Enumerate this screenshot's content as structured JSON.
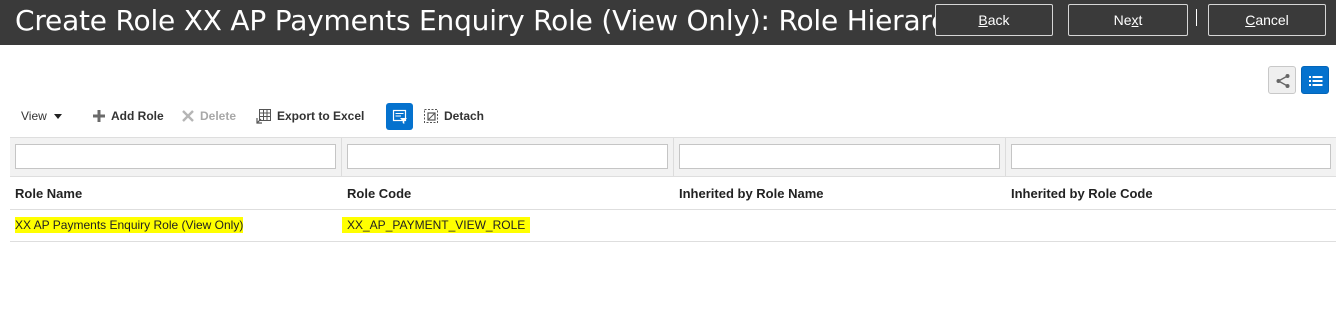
{
  "header": {
    "title": "Create Role XX AP Payments Enquiry Role (View Only): Role Hierarchy",
    "back": {
      "accesskey": "B",
      "rest": "ack"
    },
    "next": {
      "pre": "Ne",
      "accesskey": "x",
      "rest": "t"
    },
    "cancel": {
      "accesskey": "C",
      "rest": "ancel"
    }
  },
  "view_toggles": {
    "hierarchy_icon": "hierarchy-icon",
    "list_icon": "list-icon",
    "active": "list"
  },
  "toolbar": {
    "view_label": "View",
    "add_role_label": "Add Role",
    "delete_label": "Delete",
    "export_label": "Export to Excel",
    "detach_label": "Detach"
  },
  "table": {
    "filters": [
      "",
      "",
      "",
      ""
    ],
    "columns": [
      "Role Name",
      "Role Code",
      "Inherited by Role Name",
      "Inherited by Role Code"
    ],
    "rows": [
      {
        "role_name": "XX AP Payments Enquiry Role (View Only)",
        "role_code": "XX_AP_PAYMENT_VIEW_ROLE",
        "inherited_by_role_name": "",
        "inherited_by_role_code": "",
        "highlighted": true
      }
    ]
  },
  "colors": {
    "header_bg": "#3a3a3a",
    "accent": "#0572ce",
    "highlight": "#ffff00"
  }
}
